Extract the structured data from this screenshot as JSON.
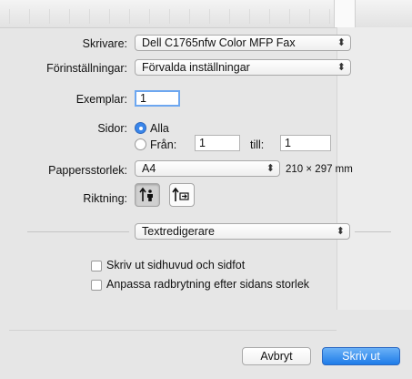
{
  "printer": {
    "label": "Skrivare:",
    "value": "Dell C1765nfw Color MFP Fax"
  },
  "presets": {
    "label": "Förinställningar:",
    "value": "Förvalda inställningar"
  },
  "copies": {
    "label": "Exemplar:",
    "value": "1"
  },
  "pages": {
    "label": "Sidor:",
    "all_label": "Alla",
    "from_label": "Från:",
    "from_value": "1",
    "to_label": "till:",
    "to_value": "1",
    "selected": "all"
  },
  "paper": {
    "label": "Pappersstorlek:",
    "value": "A4",
    "dimensions": "210 × 297 mm"
  },
  "orientation": {
    "label": "Riktning:",
    "selected": "portrait"
  },
  "section_popup": {
    "value": "Textredigerare"
  },
  "options": {
    "header_footer": "Skriv ut sidhuvud och sidfot",
    "rewrap": "Anpassa radbrytning efter sidans storlek"
  },
  "buttons": {
    "cancel": "Avbryt",
    "print": "Skriv ut"
  },
  "colors": {
    "accent": "#1e7be8"
  },
  "icons": {
    "popup_arrows": "updown-arrows-icon",
    "portrait": "portrait-orientation-icon",
    "landscape": "landscape-orientation-icon"
  }
}
